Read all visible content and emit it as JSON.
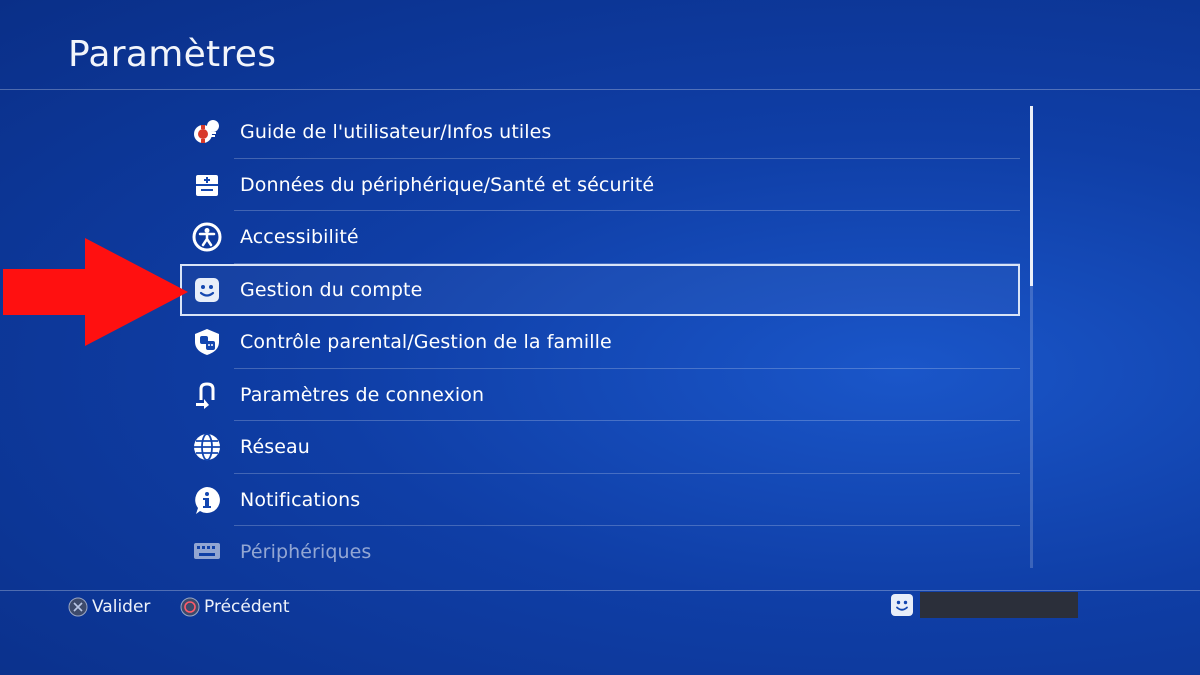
{
  "header": {
    "title": "Paramètres"
  },
  "menu": {
    "items": [
      {
        "label": "Guide de l'utilisateur/Infos utiles",
        "icon": "user-guide-icon"
      },
      {
        "label": "Données du périphérique/Santé et sécurité",
        "icon": "device-health-icon"
      },
      {
        "label": "Accessibilité",
        "icon": "accessibility-icon"
      },
      {
        "label": "Gestion du compte",
        "icon": "account-face-icon",
        "selected": true
      },
      {
        "label": "Contrôle parental/Gestion de la famille",
        "icon": "parental-control-icon"
      },
      {
        "label": "Paramètres de connexion",
        "icon": "login-settings-icon"
      },
      {
        "label": "Réseau",
        "icon": "globe-icon"
      },
      {
        "label": "Notifications",
        "icon": "info-bubble-icon"
      },
      {
        "label": "Périphériques",
        "icon": "keyboard-icon"
      }
    ]
  },
  "footer": {
    "confirm_label": "Valider",
    "back_label": "Précédent"
  },
  "colors": {
    "background": "#0f3ea6",
    "highlight_arrow": "#ff1010"
  }
}
